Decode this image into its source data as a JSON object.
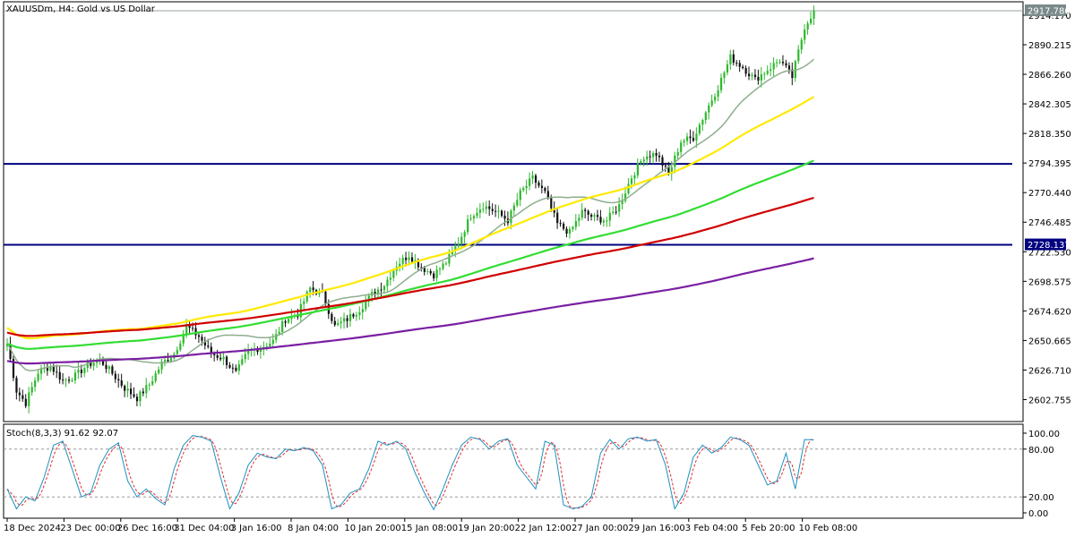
{
  "window": {
    "title": "XAUUSDm, H4:  Gold vs US Dollar"
  },
  "main_panel": {
    "price_labels": [
      "2914.170",
      "2890.215",
      "2866.260",
      "2842.305",
      "2818.350",
      "2794.395",
      "2770.440",
      "2746.485",
      "2722.530",
      "2698.575",
      "2674.620",
      "2650.665",
      "2626.710",
      "2602.755"
    ],
    "current_price_label": "2917.780",
    "hline_price_label": "2728.137",
    "colors": {
      "background": "#ffffff",
      "candle_up": "#2eb82e",
      "candle_down": "#111111",
      "hline": "#000080",
      "sma_fast": "#8fae8f",
      "sma_20": "#ffea00",
      "sma_50": "#33dd33",
      "sma_100": "#d00000",
      "sma_200": "#7a1fa2"
    }
  },
  "x_axis": {
    "labels": [
      "18 Dec 2024",
      "23 Dec 00:00",
      "26 Dec 16:00",
      "31 Dec 04:00",
      "3 Jan 16:00",
      "8 Jan 04:00",
      "10 Jan 20:00",
      "15 Jan 08:00",
      "19 Jan 20:00",
      "22 Jan 12:00",
      "27 Jan 00:00",
      "29 Jan 16:00",
      "3 Feb 04:00",
      "5 Feb 20:00",
      "10 Feb 08:00"
    ]
  },
  "stoch_panel": {
    "title": "Stoch(8,3,3) 91.62 92.07",
    "y_labels": [
      "100.00",
      "80.00",
      "20.00",
      "0.00"
    ],
    "colors": {
      "main": "#1e90c0",
      "signal": "#e03030",
      "level": "#999999"
    }
  },
  "chart_data": {
    "type": "candlestick",
    "symbol": "XAUUSDm",
    "timeframe": "H4",
    "ylim": [
      2585,
      2925
    ],
    "horizontal_lines": [
      2793.7,
      2728.137
    ],
    "current_price": 2917.78,
    "close_anchors": [
      [
        0,
        2648
      ],
      [
        3,
        2610
      ],
      [
        6,
        2600
      ],
      [
        10,
        2625
      ],
      [
        14,
        2630
      ],
      [
        18,
        2618
      ],
      [
        22,
        2622
      ],
      [
        26,
        2631
      ],
      [
        30,
        2635
      ],
      [
        34,
        2624
      ],
      [
        38,
        2612
      ],
      [
        42,
        2604
      ],
      [
        46,
        2615
      ],
      [
        50,
        2632
      ],
      [
        54,
        2640
      ],
      [
        58,
        2662
      ],
      [
        62,
        2654
      ],
      [
        66,
        2640
      ],
      [
        70,
        2636
      ],
      [
        74,
        2624
      ],
      [
        78,
        2642
      ],
      [
        82,
        2645
      ],
      [
        86,
        2650
      ],
      [
        90,
        2668
      ],
      [
        94,
        2672
      ],
      [
        98,
        2693
      ],
      [
        102,
        2688
      ],
      [
        106,
        2662
      ],
      [
        110,
        2668
      ],
      [
        114,
        2676
      ],
      [
        118,
        2688
      ],
      [
        122,
        2696
      ],
      [
        126,
        2712
      ],
      [
        130,
        2720
      ],
      [
        134,
        2710
      ],
      [
        138,
        2704
      ],
      [
        142,
        2714
      ],
      [
        146,
        2730
      ],
      [
        150,
        2752
      ],
      [
        154,
        2760
      ],
      [
        158,
        2755
      ],
      [
        162,
        2748
      ],
      [
        166,
        2770
      ],
      [
        170,
        2782
      ],
      [
        174,
        2770
      ],
      [
        178,
        2745
      ],
      [
        182,
        2738
      ],
      [
        186,
        2755
      ],
      [
        190,
        2750
      ],
      [
        194,
        2748
      ],
      [
        198,
        2760
      ],
      [
        202,
        2783
      ],
      [
        206,
        2800
      ],
      [
        210,
        2802
      ],
      [
        214,
        2785
      ],
      [
        218,
        2812
      ],
      [
        222,
        2815
      ],
      [
        226,
        2836
      ],
      [
        230,
        2856
      ],
      [
        234,
        2880
      ],
      [
        238,
        2872
      ],
      [
        242,
        2862
      ],
      [
        246,
        2870
      ],
      [
        250,
        2878
      ],
      [
        254,
        2864
      ],
      [
        258,
        2905
      ],
      [
        261,
        2917.78
      ]
    ],
    "moving_averages": [
      {
        "period": 20,
        "start": 2650,
        "end": 2876
      },
      {
        "period": 50,
        "start": 2666,
        "end": 2841
      },
      {
        "period": 100,
        "start": 2648,
        "end": 2785
      },
      {
        "period": 150,
        "start": 2658,
        "end": 2756
      },
      {
        "period": 200,
        "start": 2633,
        "end": 2706
      }
    ],
    "stochastic": {
      "params": "8,3,3",
      "main": 91.62,
      "signal": 92.07,
      "levels": [
        20,
        80
      ],
      "ylim": [
        0,
        100
      ],
      "anchors": [
        [
          0,
          30
        ],
        [
          3,
          5
        ],
        [
          6,
          20
        ],
        [
          9,
          15
        ],
        [
          12,
          45
        ],
        [
          15,
          85
        ],
        [
          18,
          90
        ],
        [
          21,
          55
        ],
        [
          24,
          20
        ],
        [
          27,
          25
        ],
        [
          30,
          60
        ],
        [
          33,
          80
        ],
        [
          36,
          88
        ],
        [
          39,
          40
        ],
        [
          42,
          20
        ],
        [
          45,
          30
        ],
        [
          48,
          18
        ],
        [
          51,
          10
        ],
        [
          54,
          55
        ],
        [
          57,
          85
        ],
        [
          60,
          97
        ],
        [
          63,
          95
        ],
        [
          66,
          90
        ],
        [
          69,
          45
        ],
        [
          72,
          5
        ],
        [
          75,
          25
        ],
        [
          78,
          60
        ],
        [
          81,
          75
        ],
        [
          84,
          70
        ],
        [
          87,
          68
        ],
        [
          90,
          80
        ],
        [
          93,
          78
        ],
        [
          96,
          82
        ],
        [
          99,
          78
        ],
        [
          102,
          60
        ],
        [
          105,
          5
        ],
        [
          108,
          10
        ],
        [
          111,
          25
        ],
        [
          114,
          30
        ],
        [
          117,
          55
        ],
        [
          120,
          90
        ],
        [
          123,
          85
        ],
        [
          126,
          90
        ],
        [
          129,
          80
        ],
        [
          132,
          50
        ],
        [
          135,
          25
        ],
        [
          138,
          4
        ],
        [
          141,
          30
        ],
        [
          144,
          60
        ],
        [
          147,
          85
        ],
        [
          150,
          95
        ],
        [
          153,
          92
        ],
        [
          156,
          80
        ],
        [
          159,
          90
        ],
        [
          162,
          93
        ],
        [
          165,
          60
        ],
        [
          168,
          45
        ],
        [
          171,
          30
        ],
        [
          174,
          90
        ],
        [
          177,
          85
        ],
        [
          180,
          10
        ],
        [
          183,
          5
        ],
        [
          186,
          8
        ],
        [
          189,
          20
        ],
        [
          192,
          75
        ],
        [
          195,
          92
        ],
        [
          198,
          80
        ],
        [
          201,
          93
        ],
        [
          204,
          95
        ],
        [
          207,
          90
        ],
        [
          210,
          92
        ],
        [
          213,
          60
        ],
        [
          216,
          5
        ],
        [
          219,
          25
        ],
        [
          222,
          70
        ],
        [
          225,
          85
        ],
        [
          228,
          75
        ],
        [
          231,
          82
        ],
        [
          234,
          95
        ],
        [
          237,
          92
        ],
        [
          240,
          85
        ],
        [
          243,
          60
        ],
        [
          246,
          35
        ],
        [
          249,
          40
        ],
        [
          252,
          75
        ],
        [
          255,
          30
        ],
        [
          258,
          92
        ],
        [
          261,
          91.62
        ]
      ]
    }
  }
}
